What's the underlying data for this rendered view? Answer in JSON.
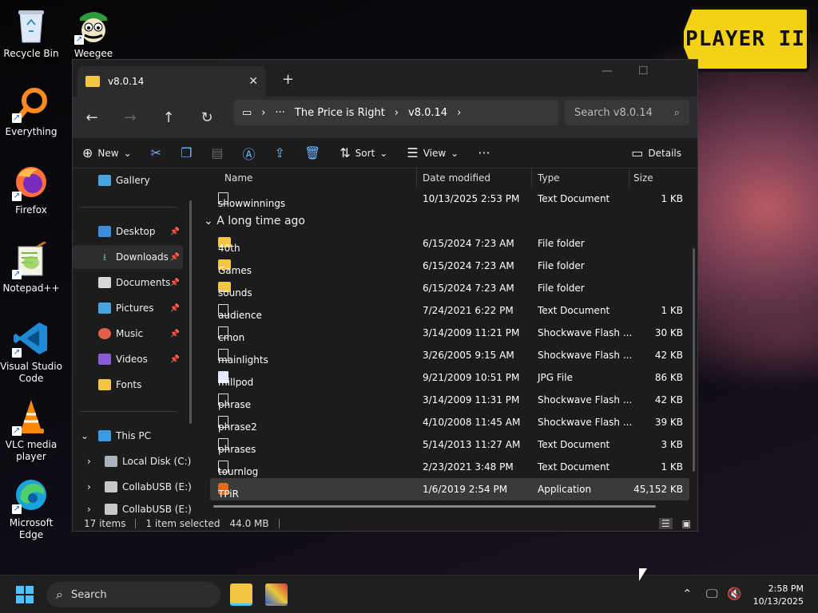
{
  "desktop": {
    "icons": [
      {
        "label": "Recycle Bin",
        "icon": "recycle-bin-icon"
      },
      {
        "label": "Weegee",
        "icon": "weegee-icon"
      },
      {
        "label": "Everything",
        "icon": "everything-search-icon"
      },
      {
        "label": "Firefox",
        "icon": "firefox-icon"
      },
      {
        "label": "Notepad++",
        "icon": "notepadpp-icon"
      },
      {
        "label": "Visual Studio Code",
        "icon": "vscode-icon"
      },
      {
        "label": "VLC media player",
        "icon": "vlc-icon"
      },
      {
        "label": "Microsoft Edge",
        "icon": "edge-icon"
      }
    ],
    "wallpaper_logo": "PLAYER II"
  },
  "explorer": {
    "tab_title": "v8.0.14",
    "breadcrumb": [
      "The Price is Right",
      "v8.0.14"
    ],
    "search_placeholder": "Search v8.0.14",
    "commands": {
      "new": "New",
      "sort": "Sort",
      "view": "View",
      "details": "Details"
    },
    "sidebar": [
      {
        "label": "Gallery",
        "icon": "gallery-icon"
      },
      {
        "label": "Desktop",
        "icon": "desktop-icon",
        "pinned": true
      },
      {
        "label": "Downloads",
        "icon": "download-icon",
        "pinned": true,
        "selected": true
      },
      {
        "label": "Documents",
        "icon": "documents-icon",
        "pinned": true
      },
      {
        "label": "Pictures",
        "icon": "pictures-icon",
        "pinned": true
      },
      {
        "label": "Music",
        "icon": "music-icon",
        "pinned": true
      },
      {
        "label": "Videos",
        "icon": "videos-icon",
        "pinned": true
      },
      {
        "label": "Fonts",
        "icon": "folder-icon"
      },
      {
        "label": "This PC",
        "icon": "this-pc-icon"
      },
      {
        "label": "Local Disk (C:)",
        "icon": "drive-icon"
      },
      {
        "label": "CollabUSB (E:)",
        "icon": "usb-drive-icon"
      },
      {
        "label": "CollabUSB (E:)",
        "icon": "usb-drive-icon"
      }
    ],
    "columns": {
      "name": "Name",
      "date": "Date modified",
      "type": "Type",
      "size": "Size"
    },
    "group_label": "A long time ago",
    "files": [
      {
        "name": "showwinnings",
        "date": "10/13/2025 2:53 PM",
        "type": "Text Document",
        "size": "1 KB",
        "icon": "text-file-icon"
      },
      {
        "name": "40th",
        "date": "6/15/2024 7:23 AM",
        "type": "File folder",
        "size": "",
        "icon": "folder-icon"
      },
      {
        "name": "Games",
        "date": "6/15/2024 7:23 AM",
        "type": "File folder",
        "size": "",
        "icon": "folder-icon"
      },
      {
        "name": "sounds",
        "date": "6/15/2024 7:23 AM",
        "type": "File folder",
        "size": "",
        "icon": "folder-icon"
      },
      {
        "name": "audience",
        "date": "7/24/2021 6:22 PM",
        "type": "Text Document",
        "size": "1 KB",
        "icon": "text-file-icon"
      },
      {
        "name": "cmon",
        "date": "3/14/2009 11:21 PM",
        "type": "Shockwave Flash ...",
        "size": "30 KB",
        "icon": "file-icon"
      },
      {
        "name": "mainlights",
        "date": "3/26/2005 9:15 AM",
        "type": "Shockwave Flash ...",
        "size": "42 KB",
        "icon": "file-icon"
      },
      {
        "name": "millpod",
        "date": "9/21/2009 10:51 PM",
        "type": "JPG File",
        "size": "86 KB",
        "icon": "image-file-icon"
      },
      {
        "name": "phrase",
        "date": "3/14/2009 11:31 PM",
        "type": "Shockwave Flash ...",
        "size": "42 KB",
        "icon": "file-icon"
      },
      {
        "name": "phrase2",
        "date": "4/10/2008 11:45 AM",
        "type": "Shockwave Flash ...",
        "size": "39 KB",
        "icon": "file-icon"
      },
      {
        "name": "phrases",
        "date": "5/14/2013 11:27 AM",
        "type": "Text Document",
        "size": "3 KB",
        "icon": "text-file-icon"
      },
      {
        "name": "tournlog",
        "date": "2/23/2021 3:48 PM",
        "type": "Text Document",
        "size": "1 KB",
        "icon": "text-file-icon"
      },
      {
        "name": "TPiR",
        "date": "1/6/2019 2:54 PM",
        "type": "Application",
        "size": "45,152 KB",
        "icon": "application-icon",
        "selected": true
      }
    ],
    "status": {
      "items": "17 items",
      "selected": "1 item selected",
      "size": "44.0 MB"
    }
  },
  "taskbar": {
    "search_label": "Search",
    "time": "2:58 PM",
    "date": "10/13/2025"
  }
}
